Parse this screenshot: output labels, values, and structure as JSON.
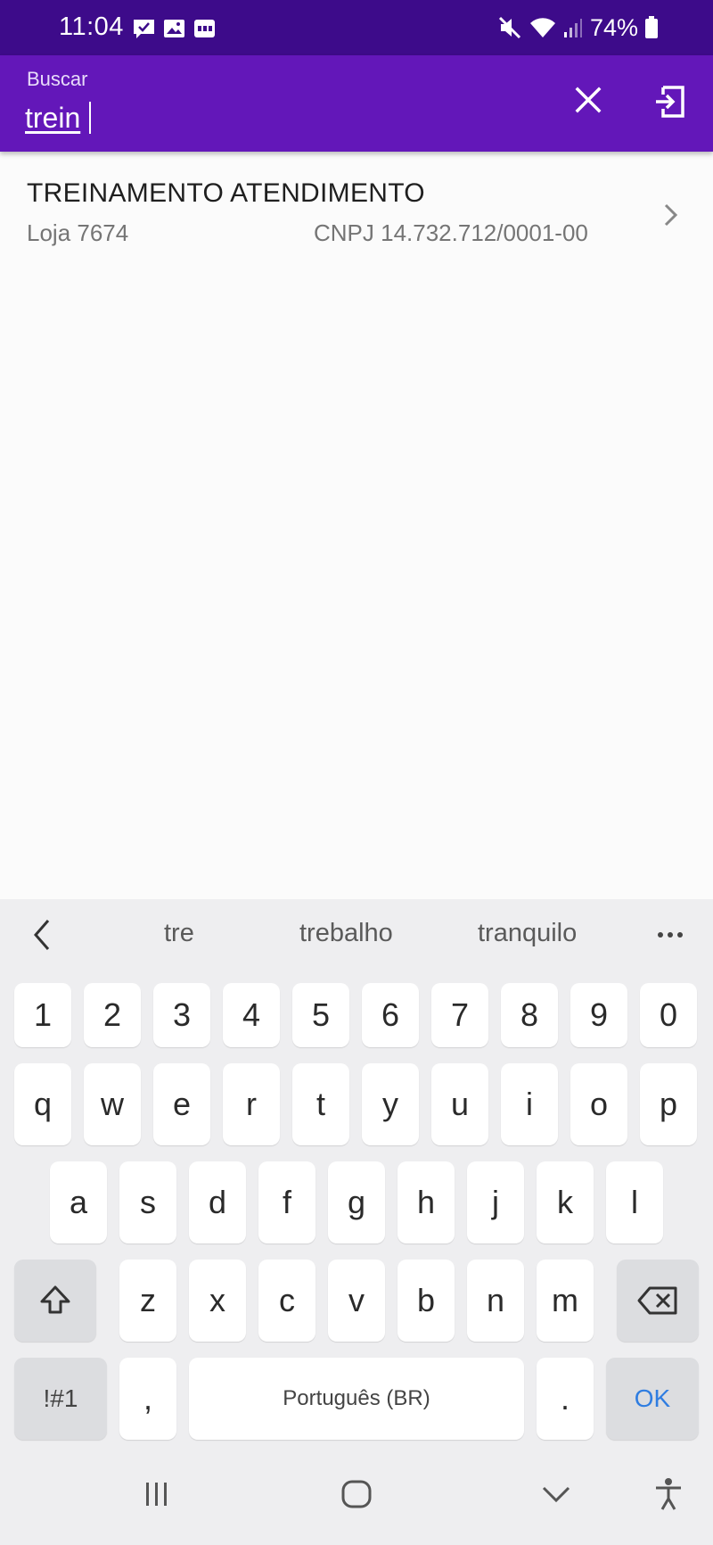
{
  "status_bar": {
    "time": "11:04",
    "battery_percent": "74%",
    "notification_icons": [
      "check-message-icon",
      "image-icon",
      "sms-icon"
    ],
    "system_icons": [
      "mute-icon",
      "wifi-icon",
      "signal-icon",
      "battery-icon"
    ]
  },
  "search": {
    "label": "Buscar",
    "value": "trein",
    "clear_icon": "close-icon",
    "exit_icon": "exit-to-app-icon"
  },
  "results": [
    {
      "title": "TREINAMENTO ATENDIMENTO",
      "store": "Loja 7674",
      "cnpj": "CNPJ 14.732.712/0001-00"
    }
  ],
  "keyboard": {
    "suggestions": [
      "tre",
      "trebalho",
      "tranquilo"
    ],
    "number_row": [
      "1",
      "2",
      "3",
      "4",
      "5",
      "6",
      "7",
      "8",
      "9",
      "0"
    ],
    "row1": [
      "q",
      "w",
      "e",
      "r",
      "t",
      "y",
      "u",
      "i",
      "o",
      "p"
    ],
    "row2": [
      "a",
      "s",
      "d",
      "f",
      "g",
      "h",
      "j",
      "k",
      "l"
    ],
    "row3": [
      "z",
      "x",
      "c",
      "v",
      "b",
      "n",
      "m"
    ],
    "symbols_label": "!#1",
    "comma_label": ",",
    "space_label": "Português (BR)",
    "period_label": ".",
    "ok_label": "OK"
  },
  "colors": {
    "status_bar": "#3d0b8a",
    "app_bar": "#6317b9",
    "ok_key": "#2f7de1"
  }
}
